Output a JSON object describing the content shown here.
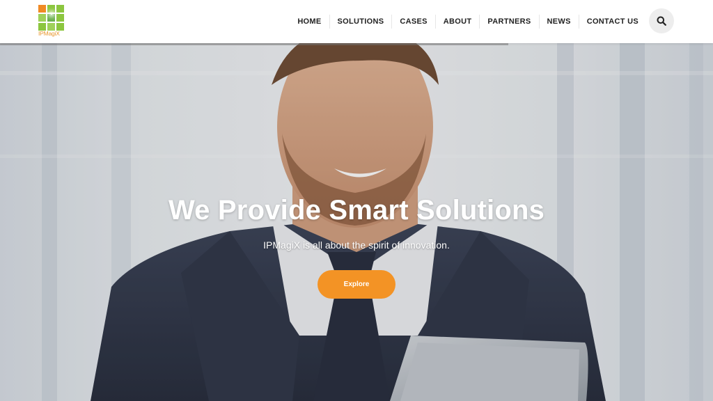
{
  "brand": {
    "logo_text": "IPMagiX",
    "logo_colors": [
      "#f08a24",
      "#8cc63f",
      "#9fd15a",
      "#6ab04c"
    ]
  },
  "nav": {
    "items": [
      {
        "label": "HOME"
      },
      {
        "label": "SOLUTIONS"
      },
      {
        "label": "CASES"
      },
      {
        "label": "ABOUT"
      },
      {
        "label": "PARTNERS"
      },
      {
        "label": "NEWS"
      },
      {
        "label": "CONTACT US"
      }
    ],
    "search_icon": "search-icon"
  },
  "hero": {
    "title": "We Provide Smart Solutions",
    "subtitle": "IPMagiX is all about the spirit of innovation.",
    "button_label": "Explore",
    "accent_color": "#f39325"
  }
}
